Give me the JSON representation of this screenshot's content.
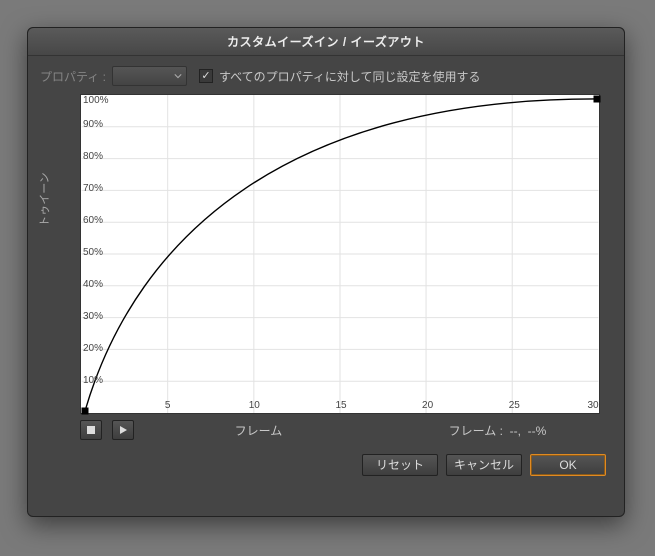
{
  "dialog": {
    "title": "カスタムイーズイン / イーズアウト"
  },
  "toprow": {
    "property_label": "プロパティ :",
    "checkbox_label": "すべてのプロパティに対して同じ設定を使用する",
    "checkbox_checked": true
  },
  "graph": {
    "y_axis_label": "トゥイーン",
    "x_axis_label": "フレーム",
    "y_ticks": [
      "10%",
      "20%",
      "30%",
      "40%",
      "50%",
      "60%",
      "70%",
      "80%",
      "90%",
      "100%"
    ],
    "x_ticks": [
      "5",
      "10",
      "15",
      "20",
      "25",
      "30"
    ]
  },
  "status": {
    "frame_label": "フレーム :",
    "frame_value": "--",
    "percent_value": "--%"
  },
  "buttons": {
    "reset": "リセット",
    "cancel": "キャンセル",
    "ok": "OK"
  },
  "chart_data": {
    "type": "line",
    "title": "",
    "xlabel": "フレーム",
    "ylabel": "トゥイーン",
    "xlim": [
      0,
      30
    ],
    "ylim": [
      0,
      100
    ],
    "x_ticks": [
      5,
      10,
      15,
      20,
      25,
      30
    ],
    "y_ticks": [
      10,
      20,
      30,
      40,
      50,
      60,
      70,
      80,
      90,
      100
    ],
    "curve_type": "bezier",
    "control_points": [
      {
        "x": 0,
        "y": 0
      },
      {
        "x": 3,
        "y": 55
      },
      {
        "x": 12,
        "y": 100
      },
      {
        "x": 30,
        "y": 100
      }
    ],
    "sampled_points": [
      {
        "x": 0,
        "y": 0
      },
      {
        "x": 2,
        "y": 23
      },
      {
        "x": 4,
        "y": 42
      },
      {
        "x": 6,
        "y": 57
      },
      {
        "x": 8,
        "y": 68
      },
      {
        "x": 10,
        "y": 77
      },
      {
        "x": 12,
        "y": 84
      },
      {
        "x": 15,
        "y": 91
      },
      {
        "x": 18,
        "y": 95
      },
      {
        "x": 21,
        "y": 98
      },
      {
        "x": 24,
        "y": 99
      },
      {
        "x": 27,
        "y": 100
      },
      {
        "x": 30,
        "y": 100
      }
    ]
  }
}
